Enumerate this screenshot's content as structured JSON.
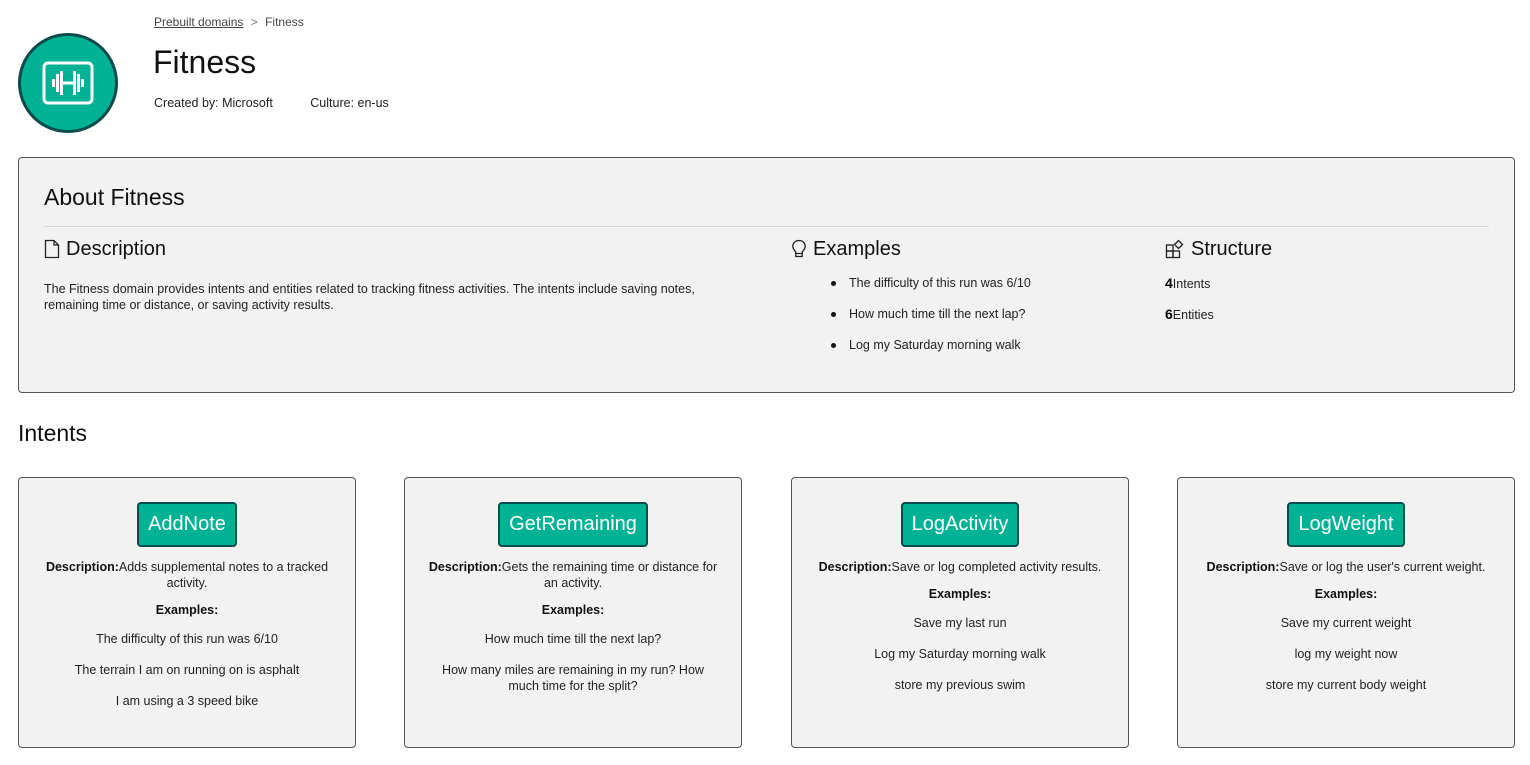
{
  "breadcrumb": {
    "parent": "Prebuilt domains",
    "separator": ">",
    "current": "Fitness"
  },
  "header": {
    "title": "Fitness",
    "created_by": "Created by: Microsoft",
    "culture": "Culture: en-us",
    "logo_icon": "dumbbell-icon",
    "brand_color": "#00b294"
  },
  "about": {
    "title": "About Fitness",
    "description": {
      "heading": "Description",
      "icon": "document-icon",
      "text": "The Fitness domain provides intents and entities related to tracking fitness activities. The intents include saving notes, remaining time or distance, or saving activity results."
    },
    "examples": {
      "heading": "Examples",
      "icon": "lightbulb-icon",
      "items": [
        "The difficulty of this run was 6/10",
        "How much time till the next lap?",
        "Log my Saturday morning walk"
      ]
    },
    "structure": {
      "heading": "Structure",
      "icon": "structure-icon",
      "items": [
        {
          "count": "4",
          "label": "Intents"
        },
        {
          "count": "6",
          "label": "Entities"
        }
      ]
    }
  },
  "intents": {
    "title": "Intents",
    "description_label": "Description:",
    "examples_label": "Examples:",
    "cards": [
      {
        "name": "AddNote",
        "description": "Adds supplemental notes to a tracked activity.",
        "examples": [
          "The difficulty of this run was 6/10",
          "The terrain I am on running on is asphalt",
          "I am using a 3 speed bike"
        ]
      },
      {
        "name": "GetRemaining",
        "description": "Gets the remaining time or distance for an activity.",
        "examples": [
          "How much time till the next lap?",
          "How many miles are remaining in my run? How much time for the split?"
        ]
      },
      {
        "name": "LogActivity",
        "description": "Save or log completed activity results.",
        "examples": [
          "Save my last run",
          "Log my Saturday morning walk",
          "store my previous swim"
        ]
      },
      {
        "name": "LogWeight",
        "description": "Save or log the user's current weight.",
        "examples": [
          "Save my current weight",
          "log my weight now",
          "store my current body weight"
        ]
      }
    ]
  }
}
